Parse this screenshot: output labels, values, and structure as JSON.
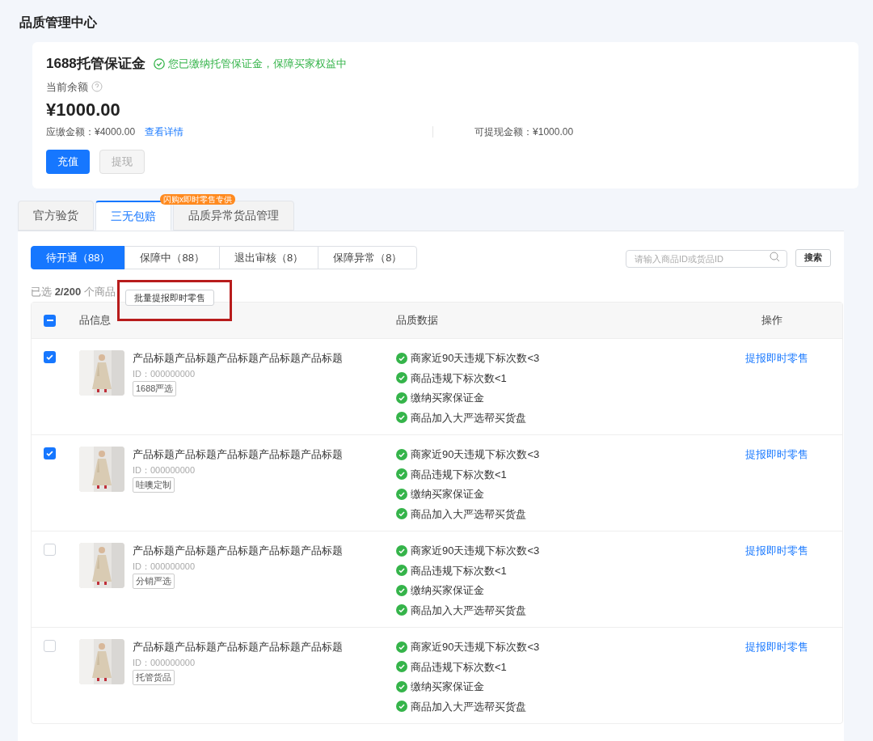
{
  "page_title": "品质管理中心",
  "deposit": {
    "title": "1688托管保证金",
    "status": "您已缴纳托管保证金，保障买家权益中",
    "balance_label": "当前余额",
    "balance": "¥1000.00",
    "due_label": "应缴金额：¥4000.00",
    "details_link": "查看详情",
    "withdrawable": "可提现金额：¥1000.00",
    "buttons": [
      {
        "label": "充值",
        "disabled": false
      },
      {
        "label": "提现",
        "disabled": true
      }
    ]
  },
  "tabs": [
    {
      "label": "官方验货",
      "selected": false
    },
    {
      "label": "三无包赔",
      "selected": true
    },
    {
      "label": "品质异常货品管理",
      "selected": false,
      "badge": "闪购x即时零售专供"
    }
  ],
  "filters": [
    {
      "label": "待开通（88）",
      "selected": true
    },
    {
      "label": "保障中（88）",
      "selected": false
    },
    {
      "label": "退出审核（8）",
      "selected": false
    },
    {
      "label": "保障异常（8）",
      "selected": false
    }
  ],
  "search": {
    "placeholder": "请输入商品ID或货品ID",
    "button": "搜索"
  },
  "selection": {
    "prefix": "已选",
    "count": "2/200",
    "suffix": "个商品",
    "batch_button": "批量提报即时零售"
  },
  "table": {
    "all_partial": true,
    "columns": [
      "品信息",
      "品质数据",
      "操作"
    ],
    "rows": [
      {
        "checked": true,
        "title": "产品标题产品标题产品标题产品标题产品标题",
        "id": "ID：000000000",
        "tag": "1688严选",
        "criteria": [
          "商家近90天违规下标次数<3",
          "商品违规下标次数<1",
          "缴纳买家保证金",
          "商品加入大严选帮买货盘"
        ],
        "action": "提报即时零售"
      },
      {
        "checked": true,
        "title": "产品标题产品标题产品标题产品标题产品标题",
        "id": "ID：000000000",
        "tag": "哇噢定制",
        "criteria": [
          "商家近90天违规下标次数<3",
          "商品违规下标次数<1",
          "缴纳买家保证金",
          "商品加入大严选帮买货盘"
        ],
        "action": "提报即时零售"
      },
      {
        "checked": false,
        "title": "产品标题产品标题产品标题产品标题产品标题",
        "id": "ID：000000000",
        "tag": "分销严选",
        "criteria": [
          "商家近90天违规下标次数<3",
          "商品违规下标次数<1",
          "缴纳买家保证金",
          "商品加入大严选帮买货盘"
        ],
        "action": "提报即时零售"
      },
      {
        "checked": false,
        "title": "产品标题产品标题产品标题产品标题产品标题",
        "id": "ID：000000000",
        "tag": "托管货品",
        "criteria": [
          "商家近90天违规下标次数<3",
          "商品违规下标次数<1",
          "缴纳买家保证金",
          "商品加入大严选帮买货盘"
        ],
        "action": "提报即时零售"
      }
    ]
  }
}
